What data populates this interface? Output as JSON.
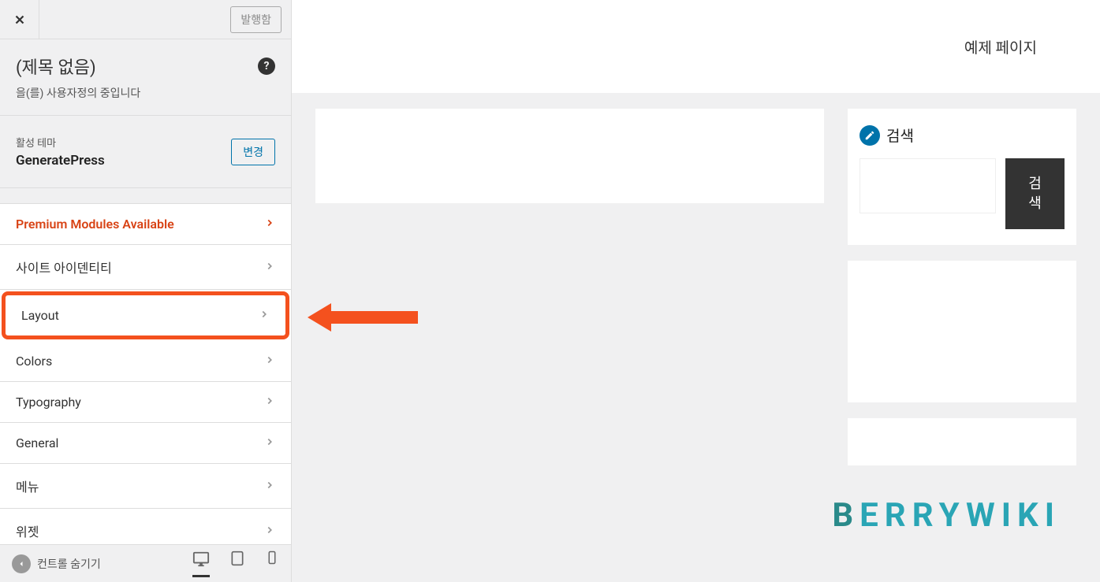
{
  "header": {
    "publish_label": "발행함"
  },
  "info": {
    "title": "(제목 없음)",
    "subtitle": "을(를) 사용자정의 중입니다",
    "help": "?"
  },
  "theme": {
    "label": "활성 테마",
    "name": "GeneratePress",
    "change_btn": "변경"
  },
  "menu": {
    "premium": "Premium Modules Available",
    "items": [
      "사이트 아이덴티티",
      "Layout",
      "Colors",
      "Typography",
      "General",
      "메뉴",
      "위젯"
    ]
  },
  "footer": {
    "hide_label": "컨트롤 숨기기"
  },
  "preview": {
    "menu_item": "예제 페이지",
    "search_title": "검색",
    "search_button": "검\n색"
  },
  "watermark": {
    "b": "B",
    "rest": "ERRYWIKI"
  }
}
